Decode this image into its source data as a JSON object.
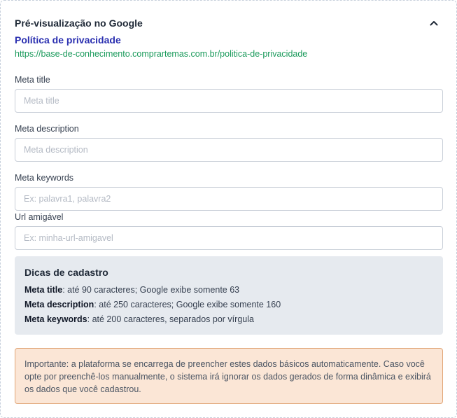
{
  "header": {
    "title": "Pré-visualização no Google",
    "collapse_icon": "chevron-up-icon"
  },
  "preview": {
    "page_title": "Política de privacidade",
    "url": "https://base-de-conhecimento.comprartemas.com.br/politica-de-privacidade"
  },
  "fields": {
    "meta_title": {
      "label": "Meta title",
      "value": "",
      "placeholder": "Meta title"
    },
    "meta_description": {
      "label": "Meta description",
      "value": "",
      "placeholder": "Meta description"
    },
    "meta_keywords": {
      "label": "Meta keywords",
      "value": "",
      "placeholder": "Ex: palavra1, palavra2"
    },
    "friendly_url": {
      "label": "Url amigável",
      "value": "",
      "placeholder": "Ex: minha-url-amigavel"
    }
  },
  "tips": {
    "title": "Dicas de cadastro",
    "items": [
      {
        "key": "Meta title",
        "text": ": até 90 caracteres; Google exibe somente 63"
      },
      {
        "key": "Meta description",
        "text": ": até 250 caracteres; Google exibe somente 160"
      },
      {
        "key": "Meta keywords",
        "text": ": até 200 caracteres, separados por vírgula"
      }
    ]
  },
  "notice": {
    "text": "Importante: a plataforma se encarrega de preencher estes dados básicos automaticamente. Caso você opte por preenchê-los manualmente, o sistema irá ignorar os dados gerados de forma dinâmica e exibirá os dados que você cadastrou."
  },
  "colors": {
    "preview_title": "#2a2fb0",
    "preview_url": "#1a9a5b",
    "tips_background": "#e6eaef",
    "notice_background": "#fbe6d6",
    "notice_border": "#e1a677"
  }
}
